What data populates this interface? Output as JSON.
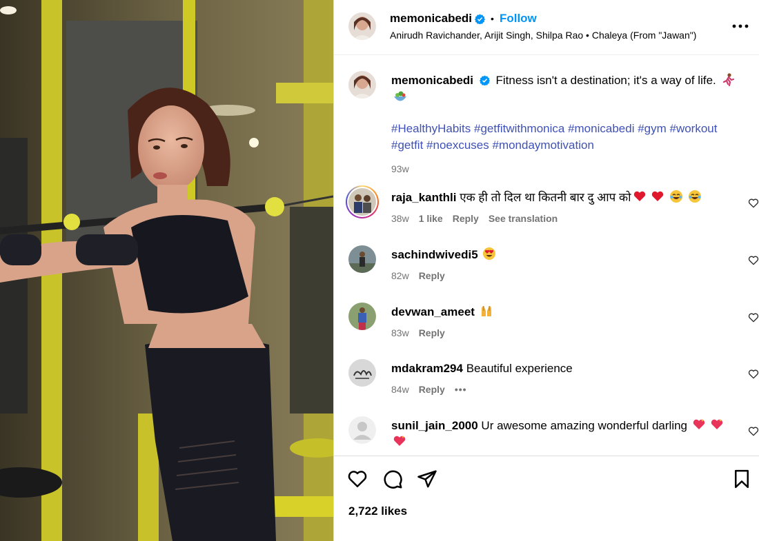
{
  "post": {
    "username": "memonicabedi",
    "follow_label": "Follow",
    "separator": "•",
    "audio": "Anirudh Ravichander, Arijit Singh, Shilpa Rao • Chaleya (From \"Jawan\")",
    "caption_user": "memonicabedi",
    "caption_text": "Fitness isn't a destination; it's a way of life.",
    "hashtags": "#HealthyHabits #getfitwithmonica #monicabedi #gym #workout #getfit #noexcuses #mondaymotivation",
    "posted_ago": "93w",
    "likes": "2,722 likes"
  },
  "comments": [
    {
      "user": "raja_kanthli",
      "text": "एक ही तो दिल था कितनी बार दु आप को",
      "emoji": [
        "heart",
        "heart",
        "joy",
        "joy"
      ],
      "time": "38w",
      "likes": "1 like",
      "reply": "Reply",
      "translate": "See translation",
      "story_ring": true
    },
    {
      "user": "sachindwivedi5",
      "text": "",
      "emoji": [
        "heart-eyes"
      ],
      "time": "82w",
      "reply": "Reply"
    },
    {
      "user": "devwan_ameet",
      "text": "",
      "emoji": [
        "raised-hands"
      ],
      "time": "83w",
      "reply": "Reply"
    },
    {
      "user": "mdakram294",
      "text": "Beautiful experience",
      "emoji": [],
      "time": "84w",
      "reply": "Reply",
      "more": "•••"
    },
    {
      "user": "sunil_jain_2000",
      "text": "Ur awesome amazing wonderful darling",
      "emoji": [
        "sparkling-heart",
        "sparkling-heart",
        "sparkling-heart"
      ]
    }
  ],
  "icons": {
    "verified": "verified-badge-icon",
    "more": "more-options-icon",
    "like": "heart-outline-icon",
    "comment": "comment-bubble-icon",
    "share": "paper-plane-icon",
    "save": "bookmark-icon"
  },
  "colors": {
    "accent": "#0095f6",
    "hashtag": "#3f51b5",
    "muted": "#737373",
    "border": "#dbdbdb"
  }
}
